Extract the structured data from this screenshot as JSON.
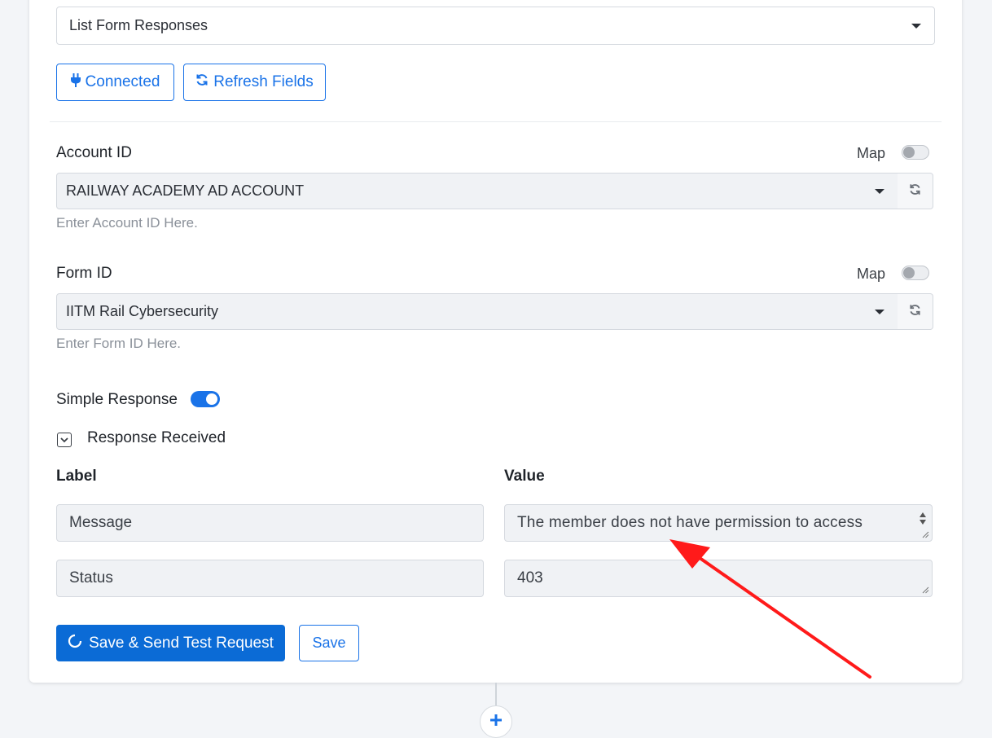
{
  "action_select": {
    "value": "List Form Responses"
  },
  "buttons": {
    "connected": "Connected",
    "refresh_fields": "Refresh Fields"
  },
  "account": {
    "label": "Account ID",
    "map_label": "Map",
    "value": "RAILWAY ACADEMY AD ACCOUNT",
    "hint": "Enter Account ID Here."
  },
  "form": {
    "label": "Form ID",
    "map_label": "Map",
    "value": "IITM Rail Cybersecurity",
    "hint": "Enter Form ID Here."
  },
  "simple_response": {
    "label": "Simple Response",
    "enabled": true
  },
  "response_received": {
    "label": "Response Received"
  },
  "table": {
    "label_header": "Label",
    "value_header": "Value",
    "rows": [
      {
        "label": "Message",
        "value": "The member does not have permission to access"
      },
      {
        "label": "Status",
        "value": "403"
      }
    ]
  },
  "footer": {
    "save_send": "Save & Send Test Request",
    "save": "Save"
  },
  "colors": {
    "accent": "#1a73e8",
    "primary_button": "#0b6bd6",
    "annotation_arrow": "#ff1a1a"
  },
  "icons": [
    "plug-icon",
    "refresh-icon",
    "chevron-down-icon",
    "spinner-icon",
    "plus-icon"
  ]
}
